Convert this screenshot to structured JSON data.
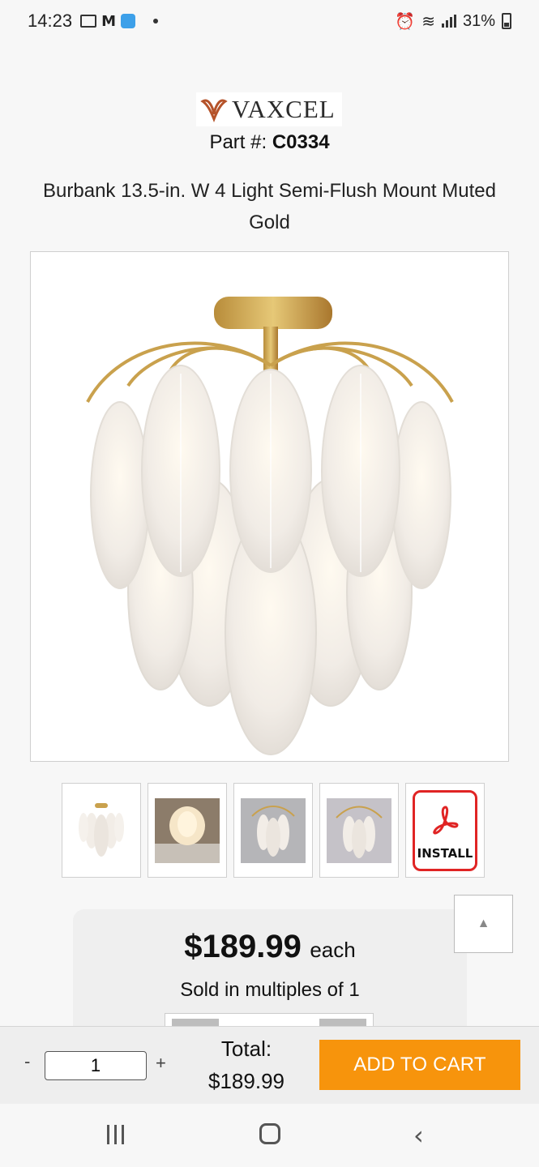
{
  "status_bar": {
    "time": "14:23",
    "battery": "31%"
  },
  "brand": {
    "name": "VAXCEL",
    "accent": "#b5532a"
  },
  "product": {
    "part_label": "Part #:",
    "part_number": "C0334",
    "title": "Burbank 13.5-in. W 4 Light Semi-Flush Mount Muted Gold"
  },
  "thumbnails": [
    {
      "name": "thumb-1"
    },
    {
      "name": "thumb-2"
    },
    {
      "name": "thumb-3"
    },
    {
      "name": "thumb-4"
    },
    {
      "name": "install-pdf",
      "label": "INSTALL"
    }
  ],
  "pricing": {
    "price": "$189.99",
    "unit": "each",
    "multiples": "Sold in multiples of 1"
  },
  "cart": {
    "minus": "-",
    "plus": "+",
    "quantity": "1",
    "total_label": "Total:",
    "total_value": "$189.99",
    "add_to_cart": "ADD TO CART",
    "button_color": "#f7940c"
  },
  "scroll_top_icon": "up-triangle-icon"
}
